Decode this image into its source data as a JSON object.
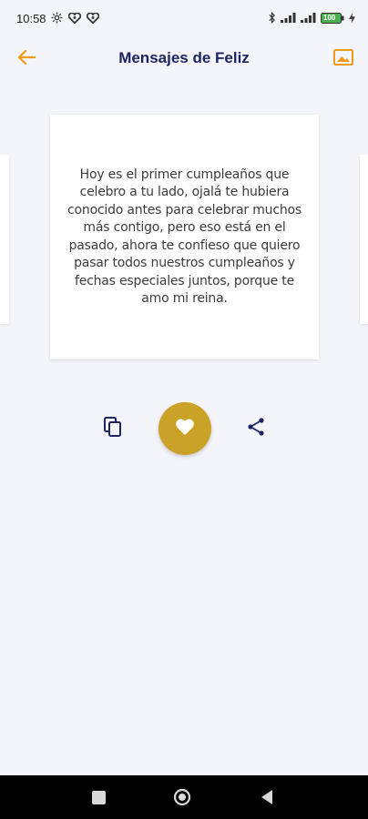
{
  "status_bar": {
    "time": "10:58",
    "left_icons": [
      "settings-gear-icon",
      "heart-dot-icon",
      "heart-dot-icon"
    ],
    "right_icons": [
      "bluetooth-icon",
      "signal-icon",
      "signal-icon",
      "battery-icon",
      "charging-bolt-icon"
    ],
    "battery_label": "100"
  },
  "app_bar": {
    "title": "Mensajes de Feliz",
    "back_icon": "arrow-left-icon",
    "image_icon": "image-icon",
    "accent_color": "#f39a1b",
    "title_color": "#1d2466"
  },
  "message_card": {
    "text": "Hoy es el primer cumpleaños que celebro a tu lado, ojalá te hubiera conocido antes para celebrar muchos más contigo, pero eso está en el pasado, ahora te confieso que quiero pasar todos nuestros cumpleaños y fechas especiales juntos, porque te amo mi reina."
  },
  "actions": {
    "copy_icon": "copy-icon",
    "favorite_icon": "heart-icon",
    "favorite_color": "#c9a227",
    "share_icon": "share-icon",
    "icon_color": "#1d2466"
  },
  "nav_bar": {
    "icons": [
      "recents-square-icon",
      "home-circle-icon",
      "back-triangle-icon"
    ]
  }
}
